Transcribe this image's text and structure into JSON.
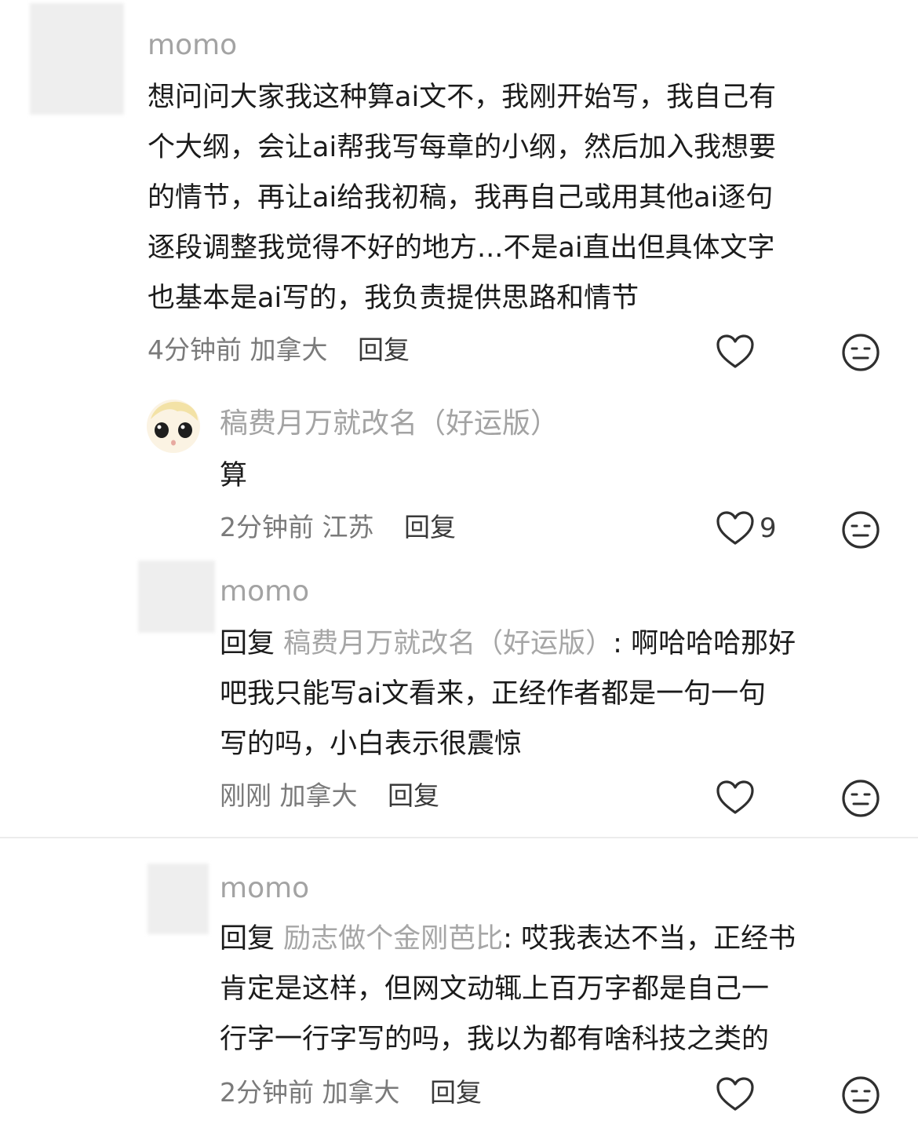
{
  "comments": [
    {
      "username": "momo",
      "lines": [
        "想问问大家我这种算ai文不，我刚开始写，我自己有",
        "个大纲，会让ai帮我写每章的小纲，然后加入我想要",
        "的情节，再让ai给我初稿，我再自己或用其他ai逐句",
        "逐段调整我觉得不好的地方...不是ai直出但具体文字",
        "也基本是ai写的，我负责提供思路和情节"
      ],
      "time": "4分钟前",
      "location": "加拿大",
      "reply_label": "回复"
    }
  ],
  "replies": [
    {
      "username": "稿费月万就改名（好运版）",
      "lines": [
        "算"
      ],
      "time": "2分钟前",
      "location": "江苏",
      "reply_label": "回复",
      "like_count": "9"
    },
    {
      "username": "momo",
      "reply_prefix": "回复",
      "reply_to": "稿费月万就改名（好运版）",
      "first_line_rest": ": 啊哈哈哈那好",
      "lines": [
        "吧我只能写ai文看来，正经作者都是一句一句",
        "写的吗，小白表示很震惊"
      ],
      "time": "刚刚",
      "location": "加拿大",
      "reply_label": "回复"
    },
    {
      "username": "momo",
      "reply_prefix": "回复",
      "reply_to": "励志做个金刚芭比",
      "first_line_rest": ": 哎我表达不当，正经书",
      "lines": [
        "肯定是这样，但网文动辄上百万字都是自己一",
        "行字一行字写的吗，我以为都有啥科技之类的"
      ],
      "time": "2分钟前",
      "location": "加拿大",
      "reply_label": "回复"
    }
  ],
  "icons": {
    "like": "heart-outline-icon",
    "dislike": "neutral-face-icon"
  }
}
